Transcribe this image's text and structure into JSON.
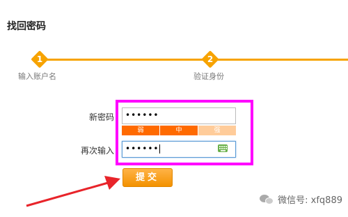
{
  "page": {
    "title": "找回密码"
  },
  "steps": [
    {
      "number": "1",
      "label": "输入账户名"
    },
    {
      "number": "2",
      "label": "验证身份"
    }
  ],
  "form": {
    "new_password_label": "新密码",
    "new_password_value": "••••••",
    "strength": {
      "weak": "弱",
      "medium": "中",
      "strong": "强"
    },
    "confirm_label": "再次输入",
    "confirm_value": "••••••",
    "submit_label": "提交"
  },
  "watermark": {
    "text": "微信号: xfq889"
  },
  "colors": {
    "accent": "#f7a300",
    "highlight": "#ff00ff",
    "arrow": "#e8242a"
  }
}
